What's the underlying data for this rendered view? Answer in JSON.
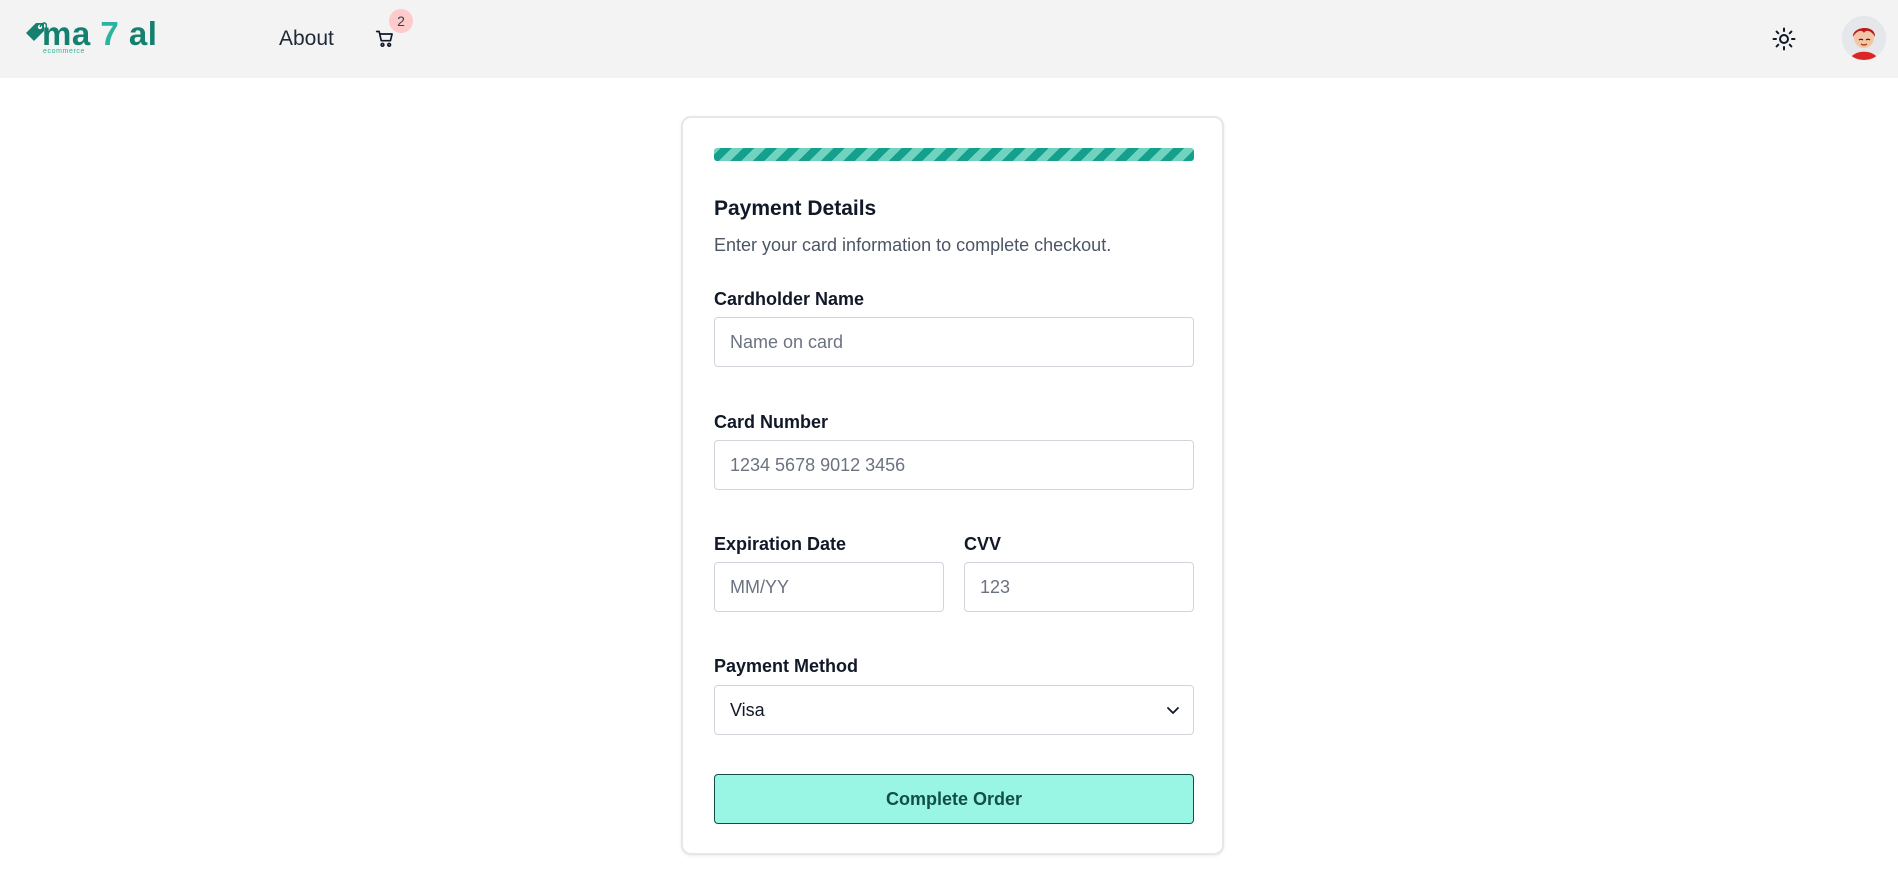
{
  "header": {
    "logo": {
      "text_main": "ma ",
      "text_seven": "7",
      "text_end": " al",
      "subtitle": "ecommerce"
    },
    "nav": {
      "about": "About"
    },
    "cart": {
      "count": "2",
      "icon": "shopping-cart-icon"
    },
    "theme_icon": "sun-icon",
    "avatar_icon": "user-avatar"
  },
  "form": {
    "progress_percent": 100,
    "title": "Payment Details",
    "subtitle": "Enter your card information to complete checkout.",
    "cardholder": {
      "label": "Cardholder Name",
      "placeholder": "Name on card",
      "value": ""
    },
    "card_number": {
      "label": "Card Number",
      "placeholder": "1234 5678 9012 3456",
      "value": ""
    },
    "expiration": {
      "label": "Expiration Date",
      "placeholder": "MM/YY",
      "value": ""
    },
    "cvv": {
      "label": "CVV",
      "placeholder": "123",
      "value": ""
    },
    "payment_method": {
      "label": "Payment Method",
      "selected": "Visa"
    },
    "submit_label": "Complete Order"
  },
  "colors": {
    "brand": "#14806f",
    "brand_light": "#2bb39f",
    "button_bg": "#99f6e4",
    "button_text": "#134e4a",
    "badge_bg": "#fecaca"
  }
}
